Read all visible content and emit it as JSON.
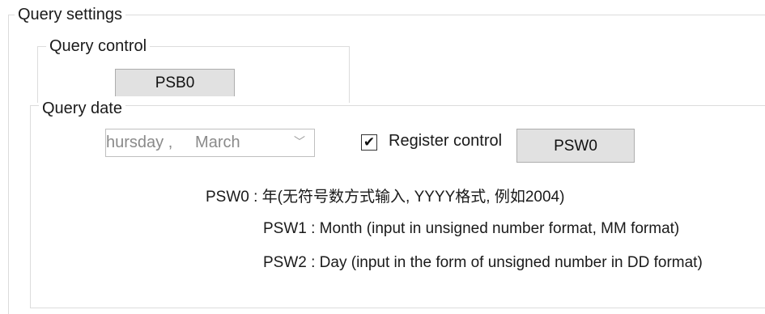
{
  "query_settings": {
    "title": "Query settings"
  },
  "query_control": {
    "title": "Query control",
    "button_label": "PSB0"
  },
  "query_date": {
    "title": "Query date",
    "date_display": "hursday ,     March",
    "register_control": {
      "checked": true,
      "check_glyph": "✔",
      "label": "Register control",
      "button_label": "PSW0"
    },
    "descriptions": [
      "PSW0 : 年(无符号数方式输入, YYYY格式, 例如2004)",
      "PSW1 : Month (input in unsigned number format, MM format)",
      "PSW2 : Day (input in the form of unsigned number in DD format)"
    ]
  },
  "icons": {
    "chevron": "﹀"
  }
}
